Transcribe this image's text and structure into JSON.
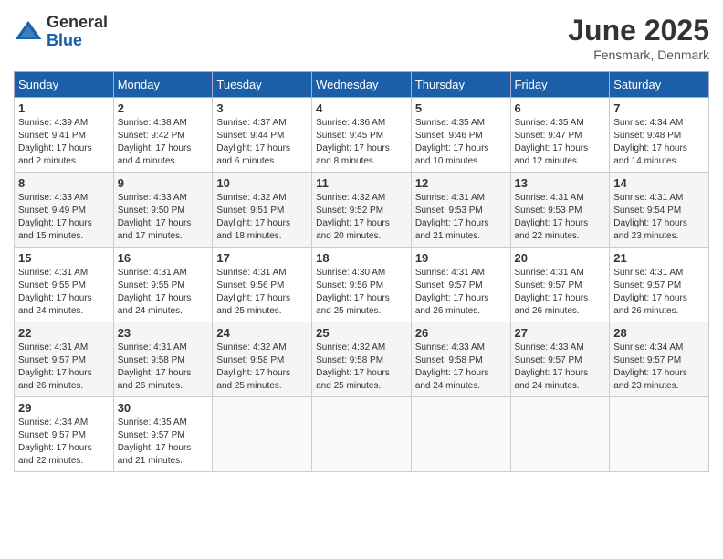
{
  "logo": {
    "general": "General",
    "blue": "Blue"
  },
  "title": "June 2025",
  "location": "Fensmark, Denmark",
  "days_header": [
    "Sunday",
    "Monday",
    "Tuesday",
    "Wednesday",
    "Thursday",
    "Friday",
    "Saturday"
  ],
  "weeks": [
    [
      {
        "day": "1",
        "sunrise": "4:39 AM",
        "sunset": "9:41 PM",
        "daylight": "17 hours and 2 minutes."
      },
      {
        "day": "2",
        "sunrise": "4:38 AM",
        "sunset": "9:42 PM",
        "daylight": "17 hours and 4 minutes."
      },
      {
        "day": "3",
        "sunrise": "4:37 AM",
        "sunset": "9:44 PM",
        "daylight": "17 hours and 6 minutes."
      },
      {
        "day": "4",
        "sunrise": "4:36 AM",
        "sunset": "9:45 PM",
        "daylight": "17 hours and 8 minutes."
      },
      {
        "day": "5",
        "sunrise": "4:35 AM",
        "sunset": "9:46 PM",
        "daylight": "17 hours and 10 minutes."
      },
      {
        "day": "6",
        "sunrise": "4:35 AM",
        "sunset": "9:47 PM",
        "daylight": "17 hours and 12 minutes."
      },
      {
        "day": "7",
        "sunrise": "4:34 AM",
        "sunset": "9:48 PM",
        "daylight": "17 hours and 14 minutes."
      }
    ],
    [
      {
        "day": "8",
        "sunrise": "4:33 AM",
        "sunset": "9:49 PM",
        "daylight": "17 hours and 15 minutes."
      },
      {
        "day": "9",
        "sunrise": "4:33 AM",
        "sunset": "9:50 PM",
        "daylight": "17 hours and 17 minutes."
      },
      {
        "day": "10",
        "sunrise": "4:32 AM",
        "sunset": "9:51 PM",
        "daylight": "17 hours and 18 minutes."
      },
      {
        "day": "11",
        "sunrise": "4:32 AM",
        "sunset": "9:52 PM",
        "daylight": "17 hours and 20 minutes."
      },
      {
        "day": "12",
        "sunrise": "4:31 AM",
        "sunset": "9:53 PM",
        "daylight": "17 hours and 21 minutes."
      },
      {
        "day": "13",
        "sunrise": "4:31 AM",
        "sunset": "9:53 PM",
        "daylight": "17 hours and 22 minutes."
      },
      {
        "day": "14",
        "sunrise": "4:31 AM",
        "sunset": "9:54 PM",
        "daylight": "17 hours and 23 minutes."
      }
    ],
    [
      {
        "day": "15",
        "sunrise": "4:31 AM",
        "sunset": "9:55 PM",
        "daylight": "17 hours and 24 minutes."
      },
      {
        "day": "16",
        "sunrise": "4:31 AM",
        "sunset": "9:55 PM",
        "daylight": "17 hours and 24 minutes."
      },
      {
        "day": "17",
        "sunrise": "4:31 AM",
        "sunset": "9:56 PM",
        "daylight": "17 hours and 25 minutes."
      },
      {
        "day": "18",
        "sunrise": "4:30 AM",
        "sunset": "9:56 PM",
        "daylight": "17 hours and 25 minutes."
      },
      {
        "day": "19",
        "sunrise": "4:31 AM",
        "sunset": "9:57 PM",
        "daylight": "17 hours and 26 minutes."
      },
      {
        "day": "20",
        "sunrise": "4:31 AM",
        "sunset": "9:57 PM",
        "daylight": "17 hours and 26 minutes."
      },
      {
        "day": "21",
        "sunrise": "4:31 AM",
        "sunset": "9:57 PM",
        "daylight": "17 hours and 26 minutes."
      }
    ],
    [
      {
        "day": "22",
        "sunrise": "4:31 AM",
        "sunset": "9:57 PM",
        "daylight": "17 hours and 26 minutes."
      },
      {
        "day": "23",
        "sunrise": "4:31 AM",
        "sunset": "9:58 PM",
        "daylight": "17 hours and 26 minutes."
      },
      {
        "day": "24",
        "sunrise": "4:32 AM",
        "sunset": "9:58 PM",
        "daylight": "17 hours and 25 minutes."
      },
      {
        "day": "25",
        "sunrise": "4:32 AM",
        "sunset": "9:58 PM",
        "daylight": "17 hours and 25 minutes."
      },
      {
        "day": "26",
        "sunrise": "4:33 AM",
        "sunset": "9:58 PM",
        "daylight": "17 hours and 24 minutes."
      },
      {
        "day": "27",
        "sunrise": "4:33 AM",
        "sunset": "9:57 PM",
        "daylight": "17 hours and 24 minutes."
      },
      {
        "day": "28",
        "sunrise": "4:34 AM",
        "sunset": "9:57 PM",
        "daylight": "17 hours and 23 minutes."
      }
    ],
    [
      {
        "day": "29",
        "sunrise": "4:34 AM",
        "sunset": "9:57 PM",
        "daylight": "17 hours and 22 minutes."
      },
      {
        "day": "30",
        "sunrise": "4:35 AM",
        "sunset": "9:57 PM",
        "daylight": "17 hours and 21 minutes."
      },
      null,
      null,
      null,
      null,
      null
    ]
  ],
  "labels": {
    "sunrise": "Sunrise:",
    "sunset": "Sunset:",
    "daylight": "Daylight:"
  }
}
